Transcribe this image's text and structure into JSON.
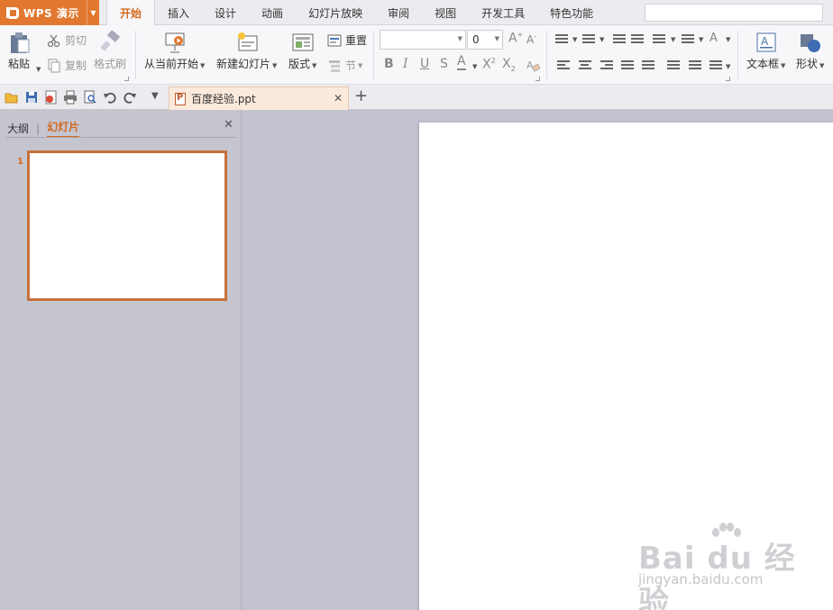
{
  "app": {
    "name": "WPS 演示",
    "accent": "#e2782f",
    "tab_accent": "#d2691e"
  },
  "menu": {
    "tabs": [
      {
        "label": "开始",
        "active": true
      },
      {
        "label": "插入"
      },
      {
        "label": "设计"
      },
      {
        "label": "动画"
      },
      {
        "label": "幻灯片放映"
      },
      {
        "label": "审阅"
      },
      {
        "label": "视图"
      },
      {
        "label": "开发工具"
      },
      {
        "label": "特色功能"
      }
    ]
  },
  "ribbon": {
    "paste": "粘贴",
    "cut": "剪切",
    "copy": "复制",
    "format_painter": "格式刷",
    "from_current": "从当前开始",
    "new_slide": "新建幻灯片",
    "layout": "版式",
    "reset": "重置",
    "section": "节",
    "font_name": "",
    "font_size": "0",
    "textbox": "文本框",
    "shape": "形状"
  },
  "document": {
    "tab_name": "百度经验.ppt"
  },
  "left_panel": {
    "tab_outline": "大纲",
    "tab_slides": "幻灯片",
    "slide_number": "1"
  },
  "watermark": {
    "brand": "Bai du 经验",
    "url": "jingyan.baidu.com"
  }
}
